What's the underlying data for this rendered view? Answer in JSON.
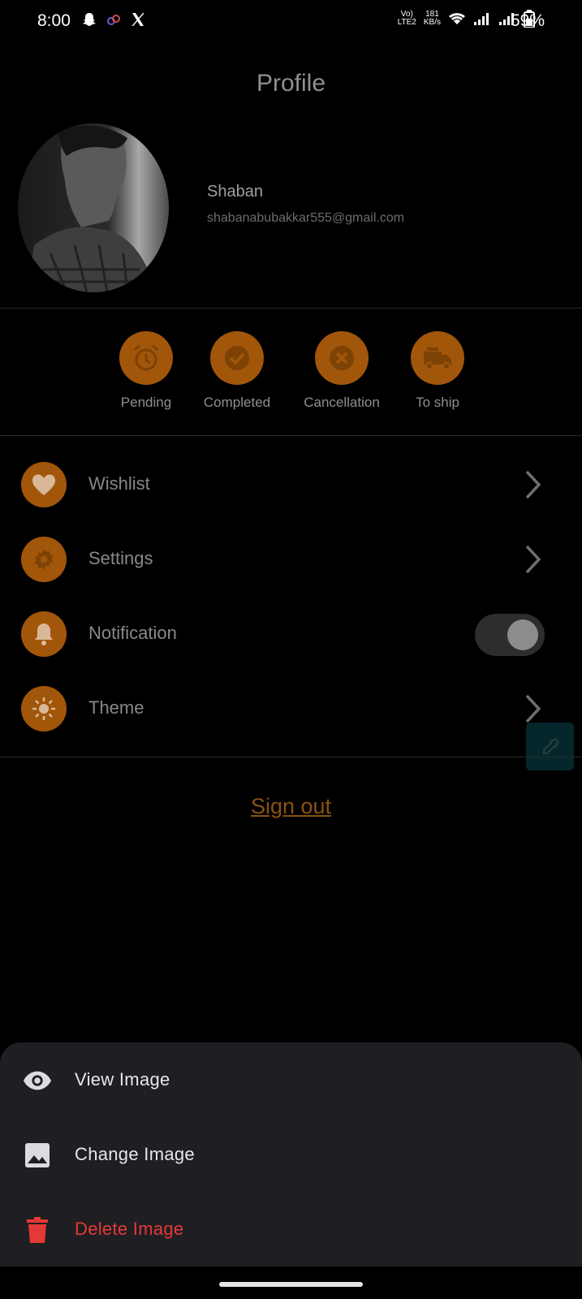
{
  "status_bar": {
    "time": "8:00",
    "network_top": "181",
    "network_bottom": "KB/s",
    "volte_top": "Vo)",
    "volte_bottom": "LTE2",
    "battery": "59%"
  },
  "header": {
    "title": "Profile"
  },
  "profile": {
    "name": "Shaban",
    "email": "shabanabubakkar555@gmail.com"
  },
  "orders": [
    {
      "label": "Pending",
      "icon": "alarm-clock-icon"
    },
    {
      "label": "Completed",
      "icon": "check-circle-icon"
    },
    {
      "label": "Cancellation",
      "icon": "cancel-circle-icon"
    },
    {
      "label": "To ship",
      "icon": "truck-icon"
    }
  ],
  "menu": [
    {
      "label": "Wishlist",
      "icon": "heart-icon"
    },
    {
      "label": "Settings",
      "icon": "gear-icon"
    },
    {
      "label": "Notification",
      "icon": "bell-icon",
      "toggle_on": true
    },
    {
      "label": "Theme",
      "icon": "sun-icon"
    }
  ],
  "signout": {
    "label": "Sign out"
  },
  "sheet": {
    "items": [
      {
        "label": "View Image",
        "icon": "eye-icon"
      },
      {
        "label": "Change Image",
        "icon": "image-icon"
      },
      {
        "label": "Delete Image",
        "icon": "trash-icon"
      }
    ]
  },
  "colors": {
    "accent": "#a1560a",
    "danger": "#e53935",
    "sheet_bg": "#1f1e22"
  }
}
